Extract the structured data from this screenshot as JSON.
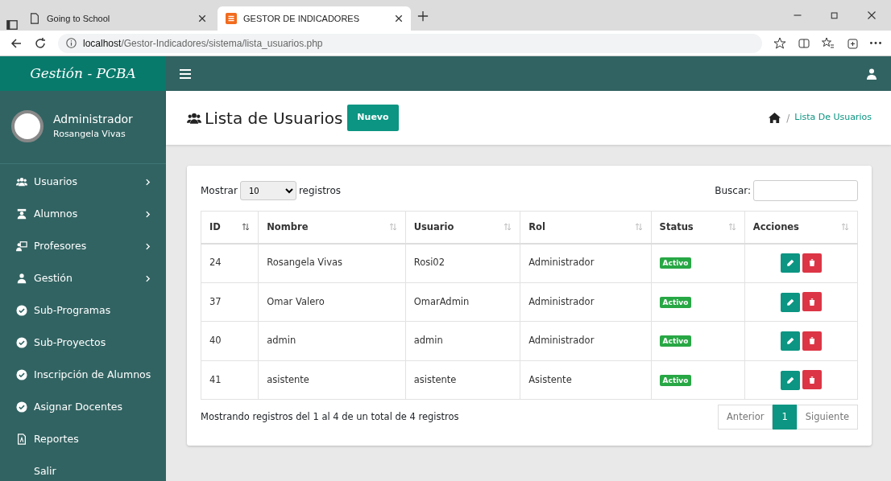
{
  "browser": {
    "tabs": [
      {
        "title": "Going to School",
        "selected": false
      },
      {
        "title": "GESTOR DE INDICADORES",
        "selected": true
      }
    ],
    "url_host": "localhost",
    "url_path": "/Gestor-Indicadores/sistema/lista_usuarios.php"
  },
  "brand": "Gestión - PCBA",
  "user": {
    "role": "Administrador",
    "name": "Rosangela Vivas"
  },
  "sidebar": {
    "items": [
      {
        "label": "Usuarios",
        "kind": "submenu"
      },
      {
        "label": "Alumnos",
        "kind": "submenu"
      },
      {
        "label": "Profesores",
        "kind": "submenu"
      },
      {
        "label": "Gestión",
        "kind": "submenu"
      },
      {
        "label": "Sub-Programas",
        "kind": "link"
      },
      {
        "label": "Sub-Proyectos",
        "kind": "link"
      },
      {
        "label": "Inscripción de Alumnos",
        "kind": "link"
      },
      {
        "label": "Asignar Docentes",
        "kind": "link"
      },
      {
        "label": "Reportes",
        "kind": "link"
      },
      {
        "label": "Salir",
        "kind": "link"
      }
    ]
  },
  "page": {
    "title": "Lista de Usuarios",
    "new_button": "Nuevo",
    "breadcrumb_separator": "/",
    "breadcrumb": "Lista De Usuarios"
  },
  "table_controls": {
    "show_label": "Mostrar",
    "page_size": "10",
    "records_label": "registros",
    "search_label": "Buscar:"
  },
  "table": {
    "columns": [
      {
        "label": "ID",
        "sorted": true
      },
      {
        "label": "Nombre",
        "sorted": false
      },
      {
        "label": "Usuario",
        "sorted": false
      },
      {
        "label": "Rol",
        "sorted": false
      },
      {
        "label": "Status",
        "sorted": false
      },
      {
        "label": "Acciones",
        "sorted": false
      }
    ],
    "rows": [
      {
        "id": "24",
        "nombre": "Rosangela Vivas",
        "usuario": "Rosi02",
        "rol": "Administrador",
        "status": "Activo"
      },
      {
        "id": "37",
        "nombre": "Omar Valero",
        "usuario": "OmarAdmin",
        "rol": "Administrador",
        "status": "Activo"
      },
      {
        "id": "40",
        "nombre": "admin",
        "usuario": "admin",
        "rol": "Administrador",
        "status": "Activo"
      },
      {
        "id": "41",
        "nombre": "asistente",
        "usuario": "asistente",
        "rol": "Asistente",
        "status": "Activo"
      }
    ]
  },
  "info": "Mostrando registros del 1 al 4 de un total de 4 registros",
  "pagination": [
    {
      "label": "Anterior",
      "selected": false
    },
    {
      "label": "1",
      "selected": true
    },
    {
      "label": "Siguiente",
      "selected": false
    }
  ]
}
